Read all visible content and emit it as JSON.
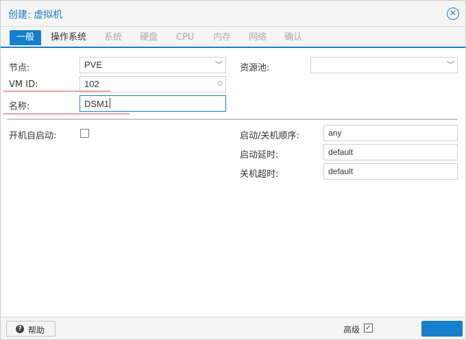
{
  "title": "创建: 虚拟机",
  "tabs": [
    {
      "label": "一般",
      "state": "active"
    },
    {
      "label": "操作系统",
      "state": "enabled"
    },
    {
      "label": "系统",
      "state": "disabled"
    },
    {
      "label": "硬盘",
      "state": "disabled"
    },
    {
      "label": "CPU",
      "state": "disabled"
    },
    {
      "label": "内存",
      "state": "disabled"
    },
    {
      "label": "网络",
      "state": "disabled"
    },
    {
      "label": "确认",
      "state": "disabled"
    }
  ],
  "form": {
    "node_label": "节点:",
    "node_value": "PVE",
    "pool_label": "资源池:",
    "pool_value": "",
    "vmid_label": "VM ID:",
    "vmid_value": "102",
    "name_label": "名称:",
    "name_value": "DSM1",
    "autostart_label": "开机自启动:",
    "autostart_checked": false,
    "order_label": "启动/关机顺序:",
    "order_value": "any",
    "startup_delay_label": "启动延时:",
    "startup_delay_value": "default",
    "shutdown_timeout_label": "关机超时:",
    "shutdown_timeout_value": "default"
  },
  "footer": {
    "help_label": "帮助",
    "advanced_label": "高级",
    "advanced_checked": true
  },
  "colors": {
    "accent": "#157fcc",
    "annotation_underline": "#e8a3a3"
  }
}
